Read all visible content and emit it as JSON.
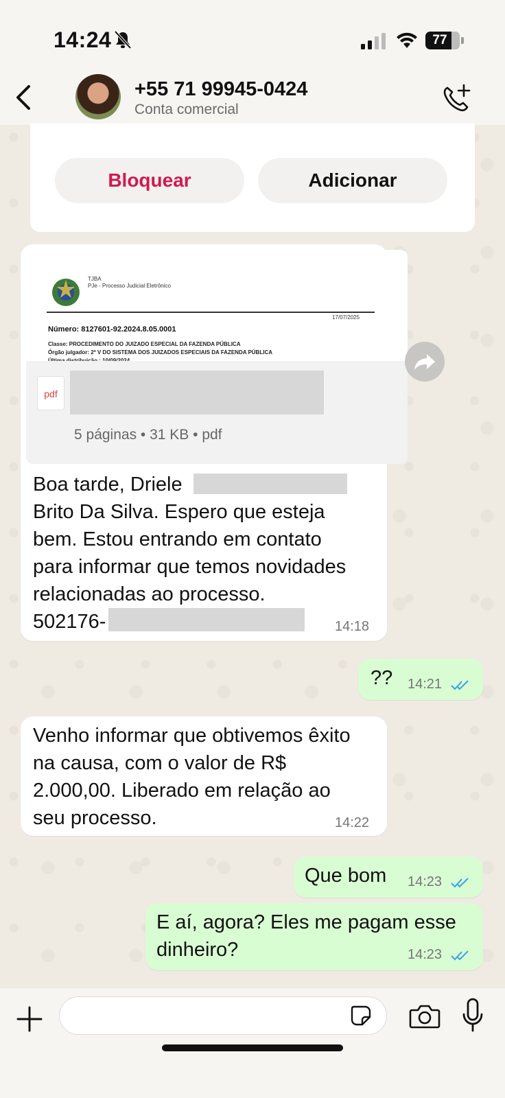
{
  "status_bar": {
    "time": "14:24",
    "battery": "77"
  },
  "header": {
    "contact": "+55 71 99945-0424",
    "subtitle": "Conta comercial"
  },
  "contact_card": {
    "block_label": "Bloquear",
    "add_label": "Adicionar"
  },
  "document": {
    "org_line1": "TJBA",
    "org_line2": "PJe - Processo Judicial Eletrônico",
    "date": "17/07/2025",
    "number": "Número: 8127601-92.2024.8.05.0001",
    "class_line": "Classe: PROCEDIMENTO DO JUIZADO ESPECIAL DA FAZENDA PÚBLICA",
    "org_judge": "Órgão julgador: 2ª V DO SISTEMA DOS JUIZADOS ESPECIAIS DA FAZENDA PÚBLICA",
    "last_dist": "Última distribuição : 10/09/2024",
    "file_icon_label": "pdf",
    "file_meta": "5 páginas • 31 KB • pdf"
  },
  "messages": [
    {
      "direction": "in",
      "lines": [
        "Boa tarde, Driele",
        "Brito Da Silva. Espero que esteja",
        "bem. Estou entrando em contato",
        "para informar que temos novidades",
        "relacionadas ao processo.",
        "502176-"
      ],
      "time": "14:18"
    },
    {
      "direction": "out",
      "text": "??",
      "time": "14:21"
    },
    {
      "direction": "in",
      "lines": [
        "Venho informar que obtivemos êxito",
        "na causa, com o valor de R$",
        "2.000,00. Liberado em relação ao",
        "seu processo."
      ],
      "time": "14:22"
    },
    {
      "direction": "out",
      "text": "Que bom",
      "time": "14:23"
    },
    {
      "direction": "out",
      "lines": [
        "E aí, agora? Eles me pagam esse",
        "dinheiro?"
      ],
      "time": "14:23"
    }
  ],
  "composer": {
    "placeholder": ""
  },
  "colors": {
    "accent_red": "#d1194f",
    "outgoing_bubble": "#d9fdd3",
    "read_tick": "#34a4e6"
  }
}
